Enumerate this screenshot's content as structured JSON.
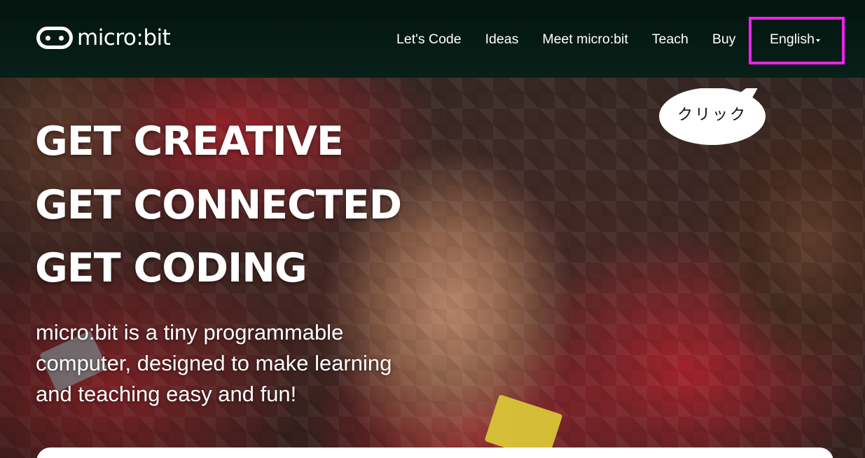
{
  "header": {
    "logo_text": "micro:bit",
    "nav": [
      {
        "label": "Let's Code"
      },
      {
        "label": "Ideas"
      },
      {
        "label": "Meet micro:bit"
      },
      {
        "label": "Teach"
      },
      {
        "label": "Buy"
      }
    ],
    "language": "English"
  },
  "hero": {
    "headline": [
      "GET CREATIVE",
      "GET CONNECTED",
      "GET CODING"
    ],
    "tagline": "micro:bit is a tiny programmable computer, designed to make learning and teaching easy and fun!"
  },
  "annotation": {
    "callout_text": "クリック",
    "highlight_color": "#ee22ee"
  },
  "icons": {
    "logo": "microbit-logo-icon",
    "language_caret": "caret-down-icon"
  }
}
